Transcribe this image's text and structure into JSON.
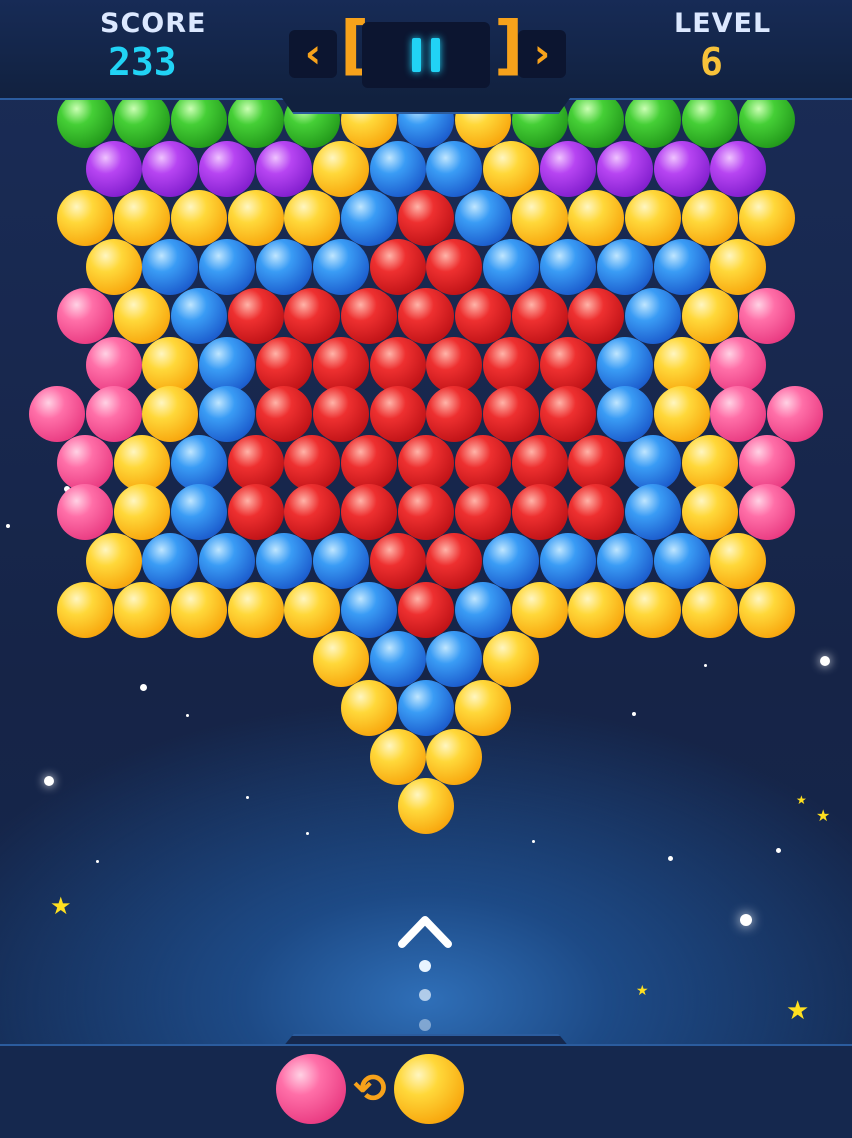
{
  "hud": {
    "score_label": "SCORE",
    "score_value": "233",
    "level_label": "LEVEL",
    "level_value": "6"
  },
  "controls": {
    "prev_icon": "chevron-left-icon",
    "pause_icon": "pause-icon",
    "next_icon": "chevron-right-icon"
  },
  "colors": {
    "yellow": "#f8a80f",
    "blue": "#1d5fcf",
    "red": "#c21418",
    "pink": "#ea3d83",
    "purple": "#8520d0",
    "green": "#249c1c",
    "score_cyan": "#21d3f5",
    "level_gold": "#f7c23a",
    "accent_orange": "#f7a21b"
  },
  "board": {
    "rows": [
      "GGGGGYBYGGGGG",
      "UUUUYBBYUUUU",
      "YYYYYBRBYYYYY",
      "YBBBBRRBBBBY",
      "PYBRRRRRRRBYP",
      "PYBRRRRRRBYP",
      "PPYBRRRRRRBYPP",
      "PYBRRRRRRRBYP",
      "PYBRRRRRRRBYP",
      "YBBBBRRBBBBY",
      "YYYYYBRBYYYYY",
      "YBBY",
      "YBY",
      "YY",
      "Y"
    ]
  },
  "shooter": {
    "current_ball": "P",
    "next_ball": "Y",
    "swap_icon": "swap-arrows-icon",
    "aim_icon": "aim-chevron-icon"
  }
}
